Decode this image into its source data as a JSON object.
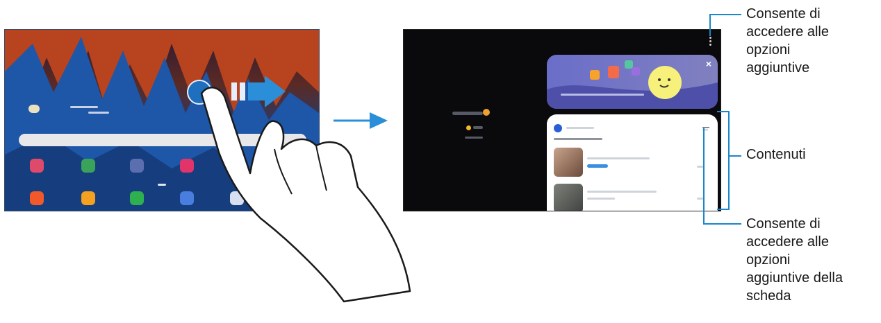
{
  "callouts": {
    "top": [
      "Consente di",
      "accedere alle",
      "opzioni",
      "aggiuntive"
    ],
    "middle": "Contenuti",
    "bottom": [
      "Consente di",
      "accedere alle",
      "opzioni",
      "aggiuntive della",
      "scheda"
    ]
  },
  "colors": {
    "accent": "#1b86c9",
    "arrow": "#2a8fd8"
  },
  "icons": {
    "more_options": "vertical-ellipsis-icon",
    "card_options": "card-options-icon",
    "close": "close-icon"
  }
}
